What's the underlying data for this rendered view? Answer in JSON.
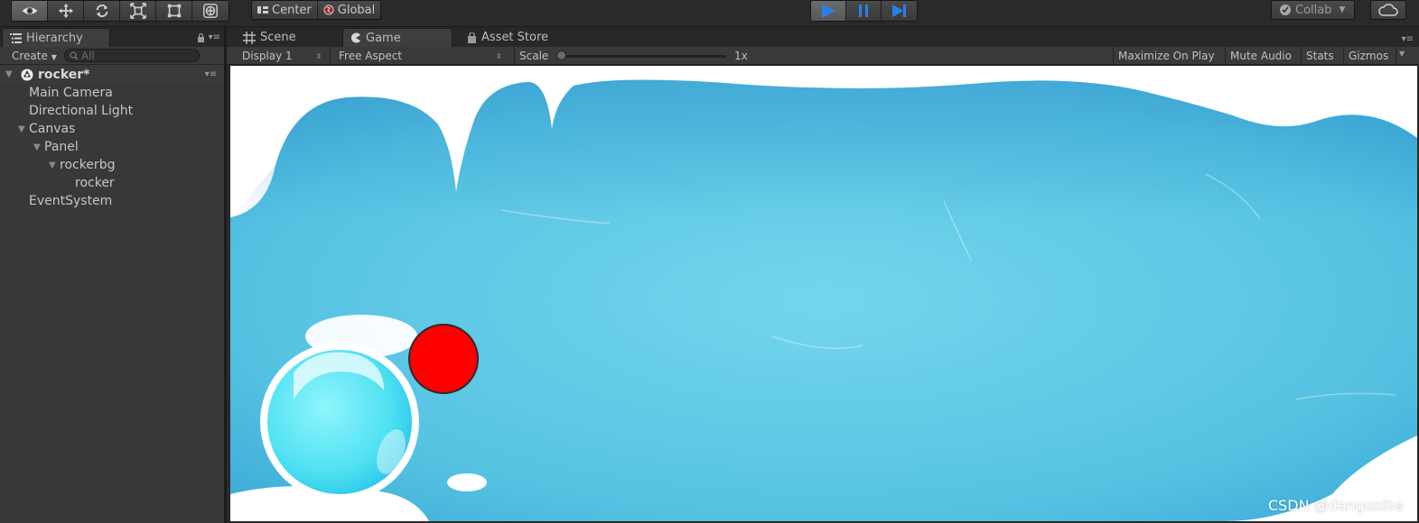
{
  "toolbar": {
    "tools": [
      "view-tool",
      "move-tool",
      "rotate-tool",
      "scale-tool",
      "rect-tool",
      "transform-tool"
    ],
    "pivot_label": "Center",
    "space_label": "Global",
    "collab_label": "Collab",
    "colors": {
      "play_active": "#2d7fe8"
    }
  },
  "hierarchy": {
    "tab_label": "Hierarchy",
    "create_label": "Create",
    "search_placeholder": "All",
    "scene_name": "rocker*",
    "items": [
      {
        "label": "Main Camera",
        "depth": 1,
        "expandable": false
      },
      {
        "label": "Directional Light",
        "depth": 1,
        "expandable": false
      },
      {
        "label": "Canvas",
        "depth": 1,
        "expandable": true
      },
      {
        "label": "Panel",
        "depth": 2,
        "expandable": true
      },
      {
        "label": "rockerbg",
        "depth": 3,
        "expandable": true
      },
      {
        "label": "rocker",
        "depth": 4,
        "expandable": false
      },
      {
        "label": "EventSystem",
        "depth": 1,
        "expandable": false
      }
    ]
  },
  "game_view": {
    "tabs": [
      {
        "label": "Scene",
        "icon": "grid-icon",
        "active": false
      },
      {
        "label": "Game",
        "icon": "pacman-icon",
        "active": true
      },
      {
        "label": "Asset Store",
        "icon": "bag-icon",
        "active": false
      }
    ],
    "display_label": "Display 1",
    "aspect_label": "Free Aspect",
    "scale_label": "Scale",
    "scale_value": "1x",
    "scale_fraction": 0.0,
    "maximize_label": "Maximize On Play",
    "mute_label": "Mute Audio",
    "stats_label": "Stats",
    "gizmos_label": "Gizmos",
    "colors": {
      "ice_water": "#5cc6e2",
      "joystick_bg": "#63e7f5",
      "joystick_knob": "#ff0000"
    }
  },
  "watermark": "CSDN @dangoxiba"
}
